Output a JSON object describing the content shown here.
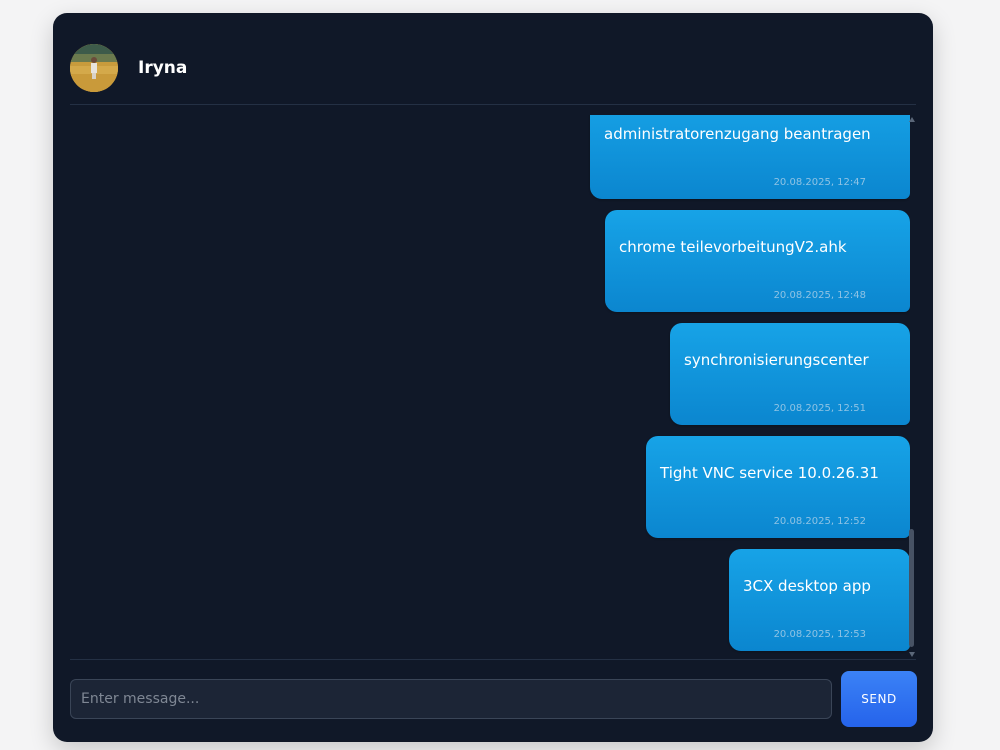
{
  "contact": {
    "name": "Iryna",
    "avatar_icon": "user-photo-avatar"
  },
  "messages": [
    {
      "text": "administratorenzugang beantragen",
      "time": "20.08.2025, 12:47"
    },
    {
      "text": "chrome teilevorbeitungV2.ahk",
      "time": "20.08.2025, 12:48"
    },
    {
      "text": "synchronisierungscenter",
      "time": "20.08.2025, 12:51"
    },
    {
      "text": "Tight VNC service 10.0.26.31",
      "time": "20.08.2025, 12:52"
    },
    {
      "text": "3CX desktop app",
      "time": "20.08.2025, 12:53"
    }
  ],
  "composer": {
    "placeholder": "Enter message...",
    "value": "",
    "send_label": "SEND"
  },
  "colors": {
    "window_bg": "#101828",
    "bubble": "#0b86cf",
    "send_button": "#2563eb"
  }
}
